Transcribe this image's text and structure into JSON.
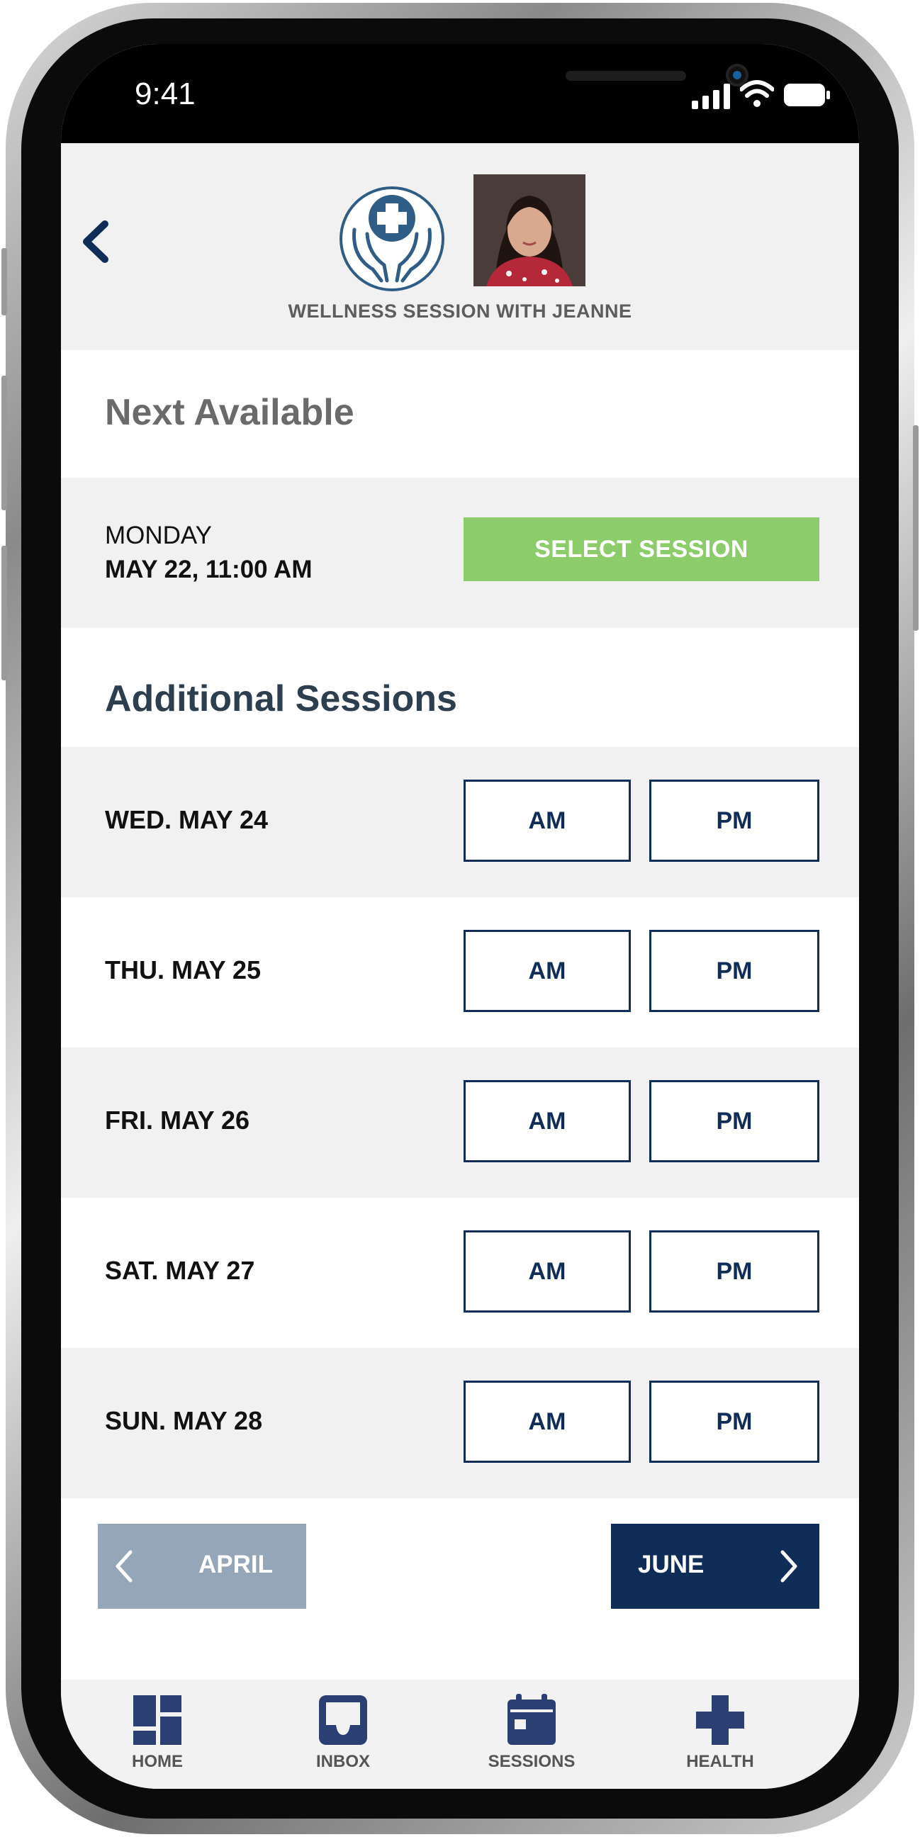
{
  "status_bar": {
    "time": "9:41"
  },
  "header": {
    "title": "WELLNESS SESSION WITH JEANNE"
  },
  "next_available": {
    "heading": "Next Available",
    "day": "MONDAY",
    "date": "MAY 22, 11:00 AM",
    "button_label": "SELECT SESSION"
  },
  "additional": {
    "heading": "Additional Sessions",
    "sessions": [
      {
        "date": "WED. MAY 24",
        "am": "AM",
        "pm": "PM"
      },
      {
        "date": "THU. MAY 25",
        "am": "AM",
        "pm": "PM"
      },
      {
        "date": "FRI. MAY 26",
        "am": "AM",
        "pm": "PM"
      },
      {
        "date": "SAT. MAY 27",
        "am": "AM",
        "pm": "PM"
      },
      {
        "date": "SUN. MAY 28",
        "am": "AM",
        "pm": "PM"
      }
    ]
  },
  "month_nav": {
    "prev_label": "APRIL",
    "next_label": "JUNE"
  },
  "tabbar": {
    "items": [
      {
        "label": "HOME",
        "icon": "home-grid-icon"
      },
      {
        "label": "INBOX",
        "icon": "inbox-tray-icon"
      },
      {
        "label": "SESSIONS",
        "icon": "calendar-icon"
      },
      {
        "label": "HEALTH",
        "icon": "health-cross-icon"
      }
    ]
  },
  "colors": {
    "navy": "#0f2d57",
    "green_button": "#8dcc6a",
    "prev_button": "#94a6b8",
    "row_grey": "#f1f1f1",
    "heading_dark": "#2d3e4e",
    "tab_icon": "#2c3f73"
  }
}
